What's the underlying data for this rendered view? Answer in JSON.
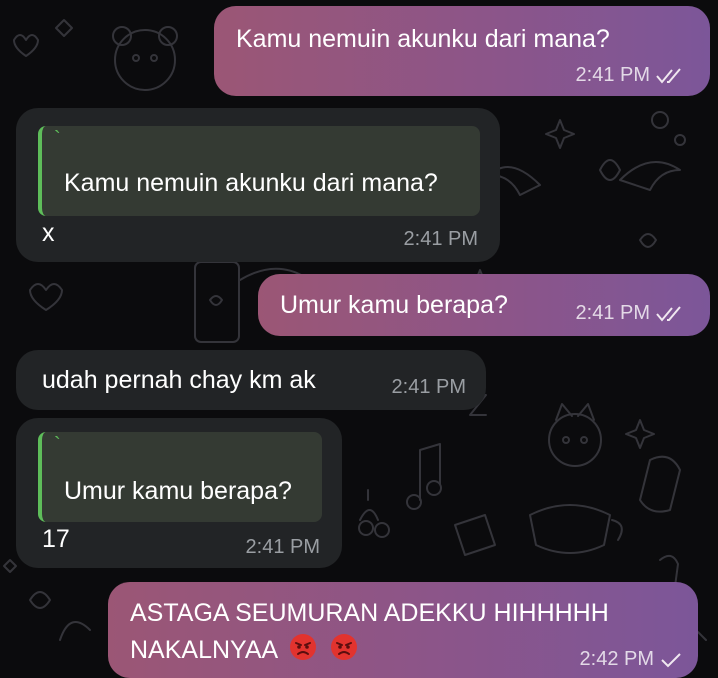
{
  "messages": [
    {
      "direction": "outgoing",
      "text": "Kamu nemuin akunku dari mana?",
      "time": "2:41 PM",
      "status": "read"
    },
    {
      "direction": "incoming",
      "reply_to": {
        "marker": "`",
        "text": "Kamu nemuin akunku dari mana?"
      },
      "text": "x",
      "time": "2:41 PM"
    },
    {
      "direction": "outgoing",
      "text": "Umur kamu berapa?",
      "time": "2:41 PM",
      "status": "read"
    },
    {
      "direction": "incoming",
      "text": "udah pernah chay km ak",
      "time": "2:41 PM"
    },
    {
      "direction": "incoming",
      "reply_to": {
        "marker": "`",
        "text": "Umur kamu berapa?"
      },
      "text": "17",
      "time": "2:41 PM"
    },
    {
      "direction": "outgoing",
      "lines": [
        "ASTAGA SEUMURAN ADEKKU HIHHHHH",
        "NAKALNYAA"
      ],
      "emoji": [
        "angry-face",
        "angry-face"
      ],
      "time": "2:42 PM",
      "status": "sent"
    }
  ],
  "colors": {
    "background": "#0b0b0d",
    "incoming_bubble": "#222426",
    "outgoing_bubble_start": "#9b5675",
    "outgoing_bubble_end": "#7c5699",
    "reply_bar": "#5ebd5a",
    "reply_background": "#343a33"
  }
}
